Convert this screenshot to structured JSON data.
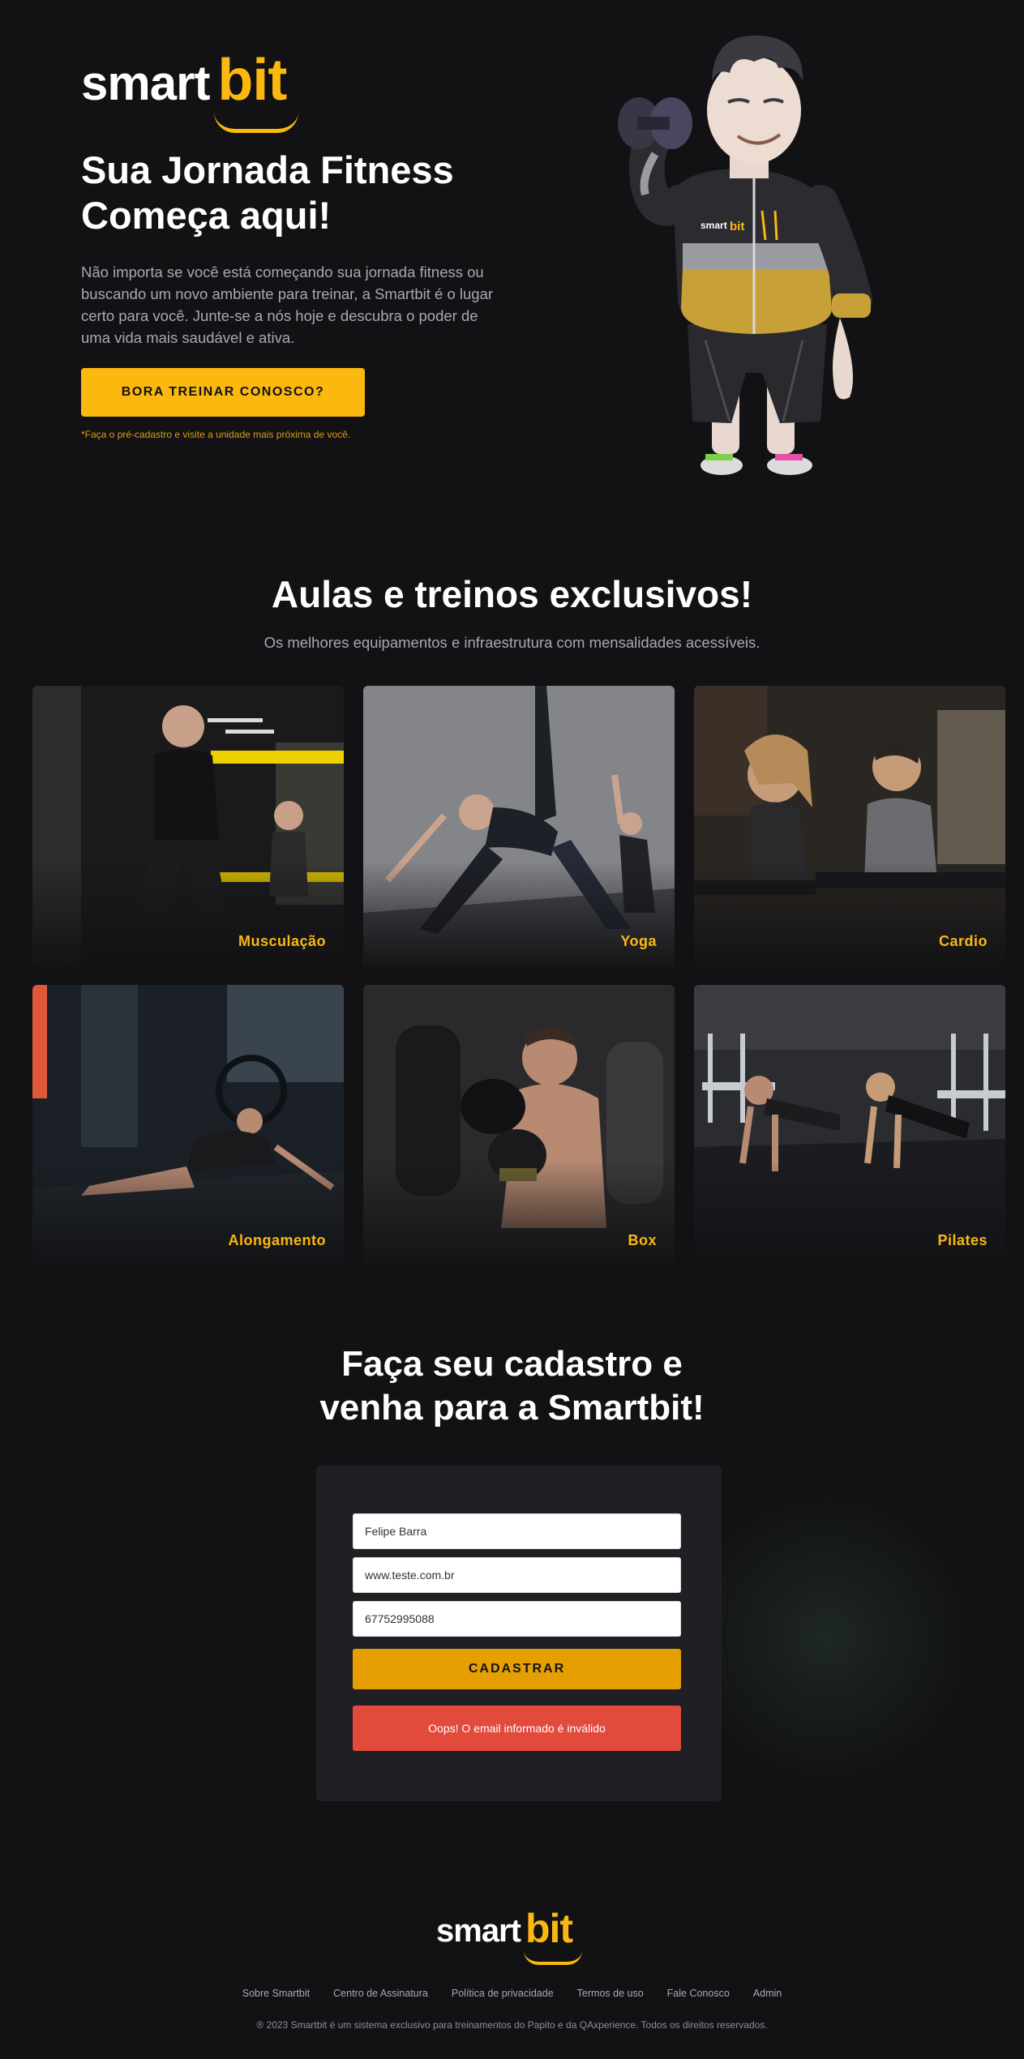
{
  "brand": {
    "smart": "smart",
    "bit": "bit",
    "accent": "#fbb80f"
  },
  "hero": {
    "title_line1": "Sua Jornada Fitness",
    "title_line2": "Começa aqui!",
    "text": "Não importa se você está começando sua jornada fitness ou buscando um novo ambiente para treinar, a Smartbit é o lugar certo para você. Junte-se a nós hoje e descubra o poder de uma vida mais saudável e ativa.",
    "cta": "BORA TREINAR CONOSCO?",
    "note": "*Faça o pré-cadastro e visite a unidade mais próxima de você.",
    "mascot": "smartbit-mascot-with-dumbbell"
  },
  "classes": {
    "title": "Aulas e treinos exclusivos!",
    "subtitle": "Os melhores equipamentos e infraestrutura com mensalidades acessíveis.",
    "items": [
      {
        "label": "Musculação"
      },
      {
        "label": "Yoga"
      },
      {
        "label": "Cardio"
      },
      {
        "label": "Alongamento"
      },
      {
        "label": "Box"
      },
      {
        "label": "Pilates"
      }
    ]
  },
  "signup": {
    "title_line1": "Faça seu cadastro e",
    "title_line2": "venha para a Smartbit!",
    "name_value": "Felipe Barra",
    "email_value": "www.teste.com.br",
    "phone_value": "67752995088",
    "submit": "CADASTRAR",
    "error": "Oops! O email informado é inválido"
  },
  "footer": {
    "links": [
      "Sobre Smartbit",
      "Centro de Assinatura",
      "Política de privacidade",
      "Termos de uso",
      "Fale Conosco",
      "Admin"
    ],
    "copyright": "® 2023 Smartbit é um sistema exclusivo para treinamentos do Papito e da QAxperience. Todos os direitos reservados."
  }
}
